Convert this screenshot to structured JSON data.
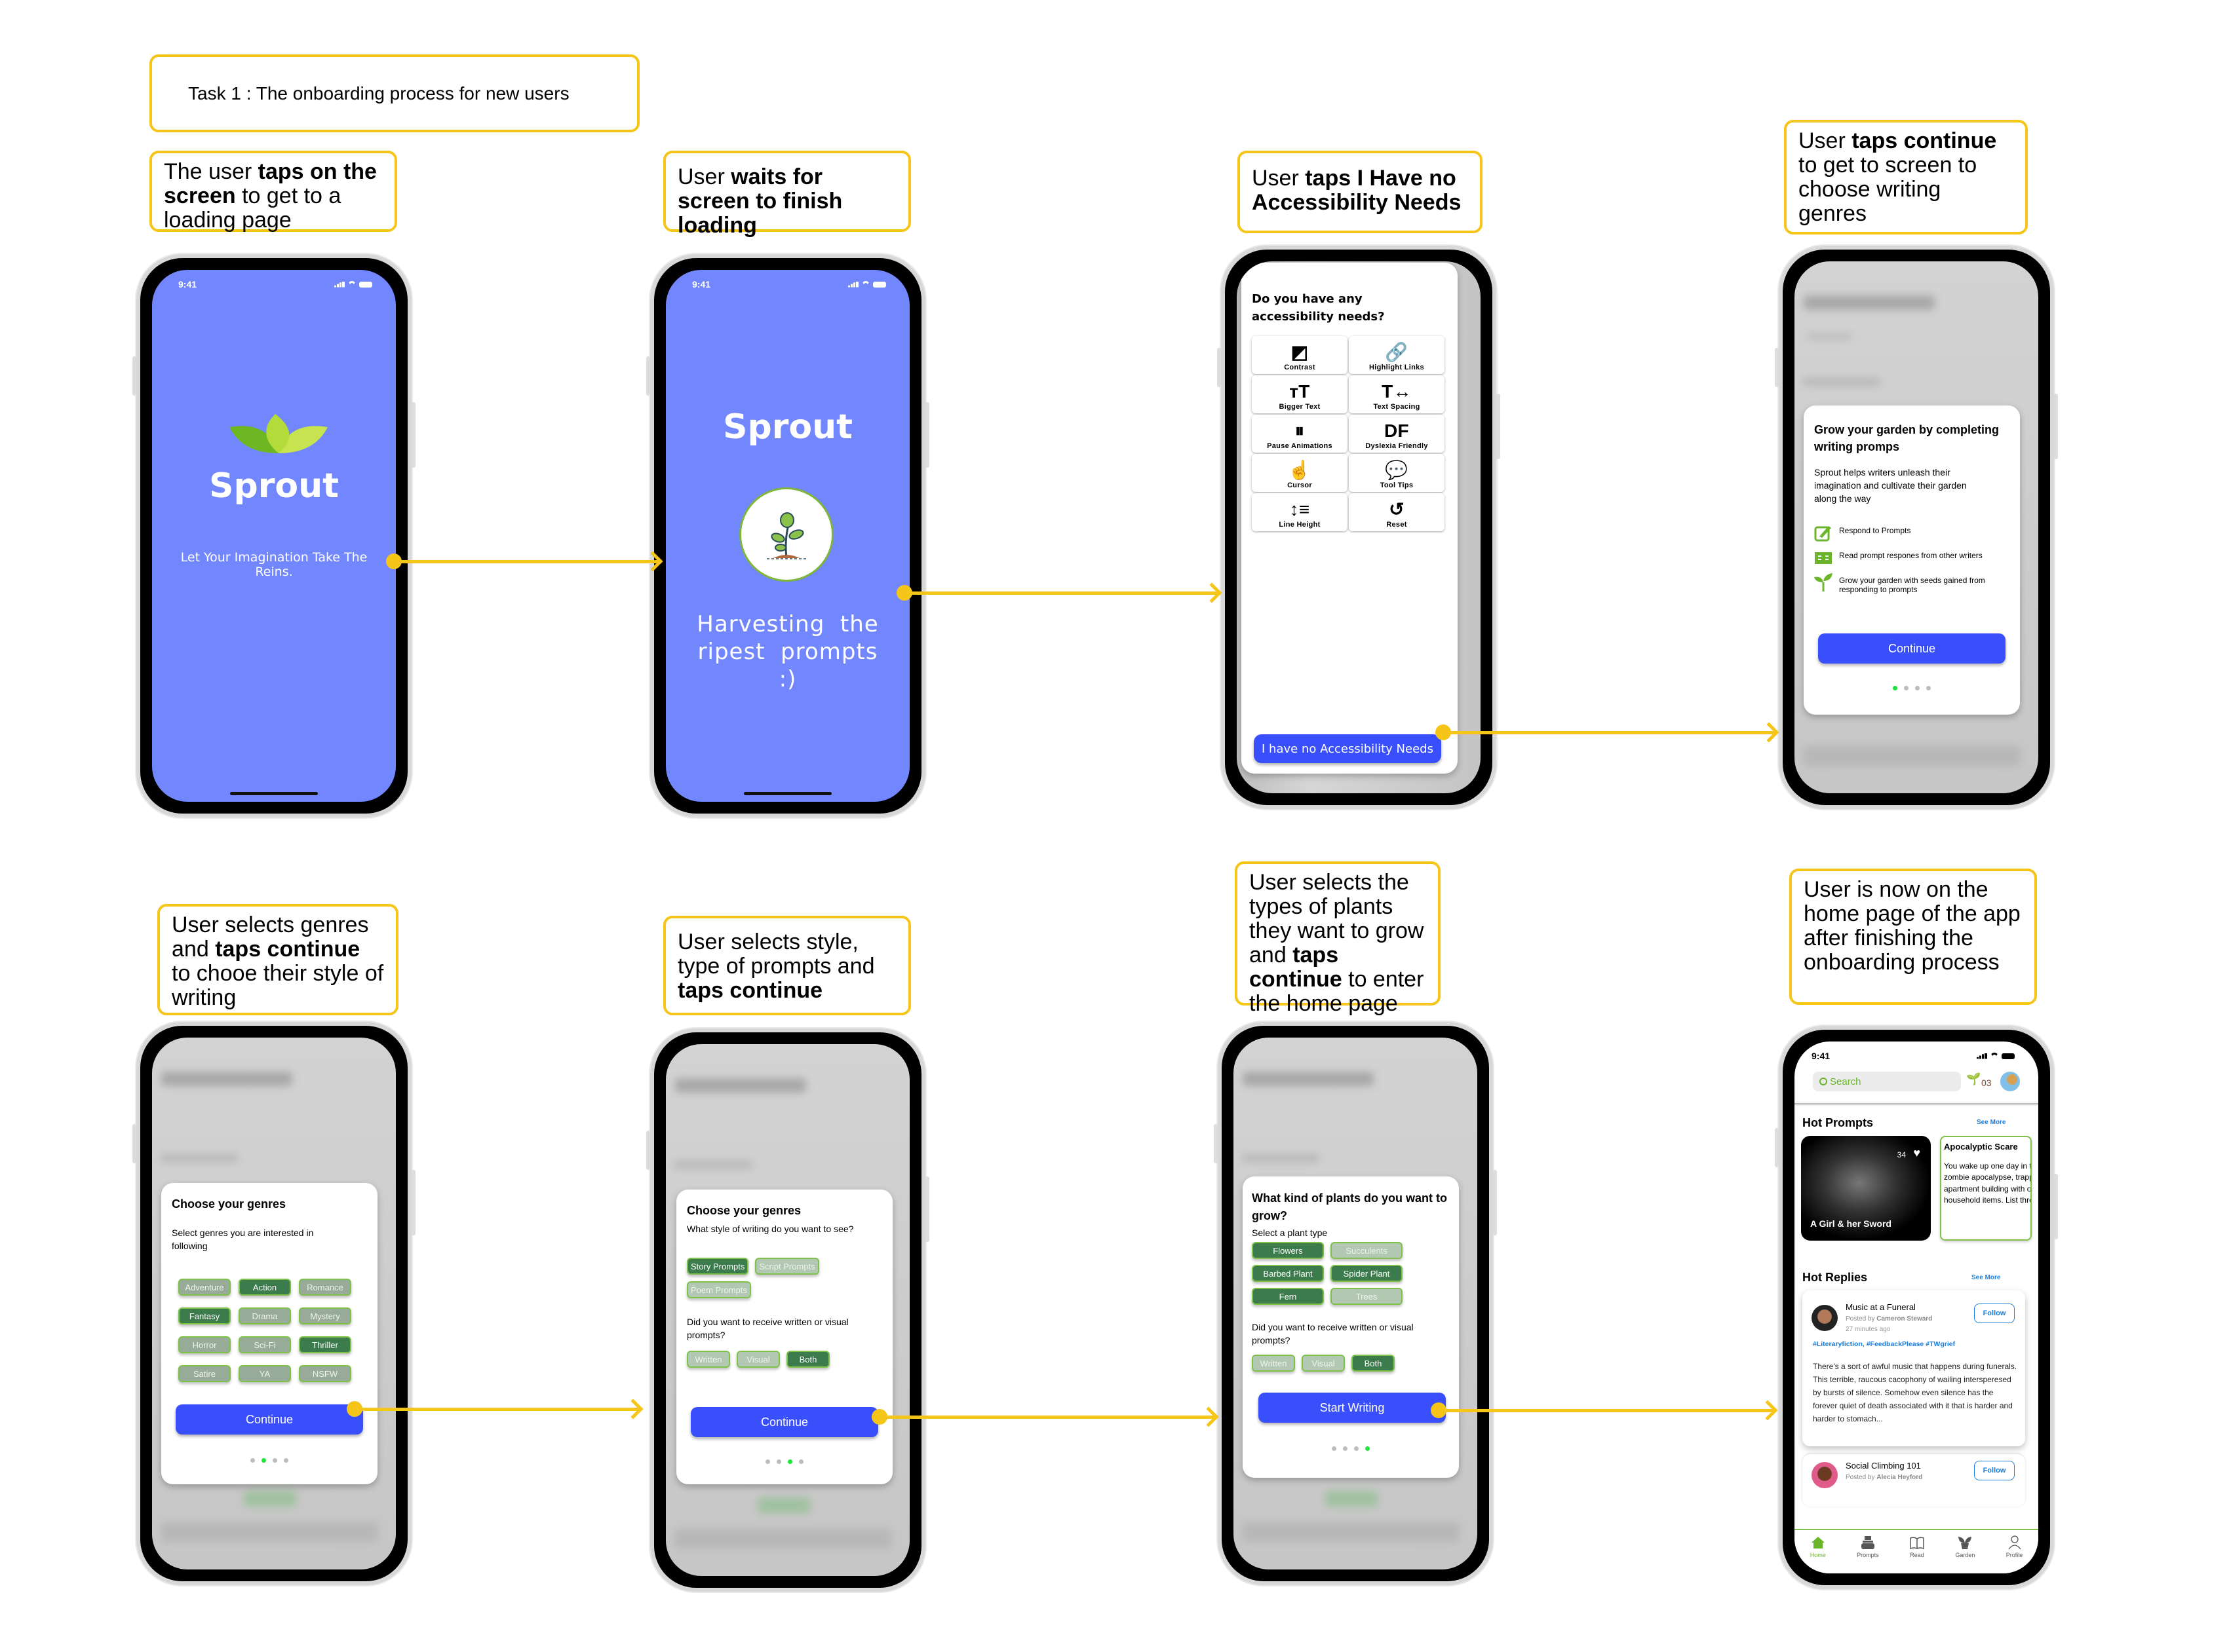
{
  "task_title": "Task 1 : The onboarding process for new users",
  "steps": [
    {
      "parts": [
        {
          "t": "The user "
        },
        {
          "t": "taps on the screen",
          "b": true
        },
        {
          "t": " to get to a loading page"
        }
      ]
    },
    {
      "parts": [
        {
          "t": "User "
        },
        {
          "t": "waits for screen to finish loading",
          "b": true
        }
      ]
    },
    {
      "parts": [
        {
          "t": "User "
        },
        {
          "t": "taps I Have no Accessibility Needs",
          "b": true
        }
      ]
    },
    {
      "parts": [
        {
          "t": "User "
        },
        {
          "t": "taps continue",
          "b": true
        },
        {
          "t": " to get to screen to choose writing genres"
        }
      ]
    },
    {
      "parts": [
        {
          "t": "User selects genres and "
        },
        {
          "t": "taps continue",
          "b": true
        },
        {
          "t": " to chooe their style of writing"
        }
      ]
    },
    {
      "parts": [
        {
          "t": "User selects style, type of prompts and "
        },
        {
          "t": "taps continue",
          "b": true
        }
      ]
    },
    {
      "parts": [
        {
          "t": "User selects the types of plants they want to grow and "
        },
        {
          "t": "taps continue",
          "b": true
        },
        {
          "t": " to enter the home page"
        }
      ]
    },
    {
      "parts": [
        {
          "t": "User is now on the home page of the app after finishing the onboarding process"
        }
      ]
    }
  ],
  "status_time": "9:41",
  "splash": {
    "app_name": "Sprout",
    "tagline": "Let Your Imagination Take The Reins."
  },
  "loading": {
    "app_name": "Sprout",
    "message": "Harvesting  the ripest  prompts  :)"
  },
  "accessibility": {
    "title": "Do you have any accessibility needs?",
    "options": [
      {
        "label": "Contrast",
        "icon": "contrast-icon",
        "glyph": "◩"
      },
      {
        "label": "Highlight Links",
        "icon": "link-icon",
        "glyph": "🔗"
      },
      {
        "label": "Bigger Text",
        "icon": "text-size-icon",
        "glyph": "тT"
      },
      {
        "label": "Text Spacing",
        "icon": "text-spacing-icon",
        "glyph": "T↔"
      },
      {
        "label": "Pause Animations",
        "icon": "pause-icon",
        "glyph": "⏸"
      },
      {
        "label": "Dyslexia Friendly",
        "icon": "dyslexia-icon",
        "glyph": "DF"
      },
      {
        "label": "Cursor",
        "icon": "cursor-hand-icon",
        "glyph": "☝"
      },
      {
        "label": "Tool Tips",
        "icon": "tooltip-icon",
        "glyph": "💬"
      },
      {
        "label": "Line Height",
        "icon": "line-height-icon",
        "glyph": "↕≡"
      },
      {
        "label": "Reset",
        "icon": "reset-icon",
        "glyph": "↺"
      }
    ],
    "button": "I have no Accessibility Needs"
  },
  "intro": {
    "bg_title": "Story Weaver",
    "title": "Grow your garden by completing writing promps",
    "body": "Sprout helps writers unleash their imagination and cultivate their garden along the way",
    "features": [
      {
        "icon": "edit-icon",
        "text": "Respond to Prompts"
      },
      {
        "icon": "book-icon",
        "text": "Read prompt respones from other writers"
      },
      {
        "icon": "sprout-icon",
        "text": "Grow your garden with seeds gained from responding to prompts"
      }
    ],
    "button": "Continue",
    "page": 1,
    "pages": 4
  },
  "genres": {
    "title": "Choose your genres",
    "subtitle": "Select genres you are interested in following",
    "options": [
      {
        "label": "Adventure",
        "selected": false
      },
      {
        "label": "Action",
        "selected": true
      },
      {
        "label": "Romance",
        "selected": false
      },
      {
        "label": "Fantasy",
        "selected": true
      },
      {
        "label": "Drama",
        "selected": false
      },
      {
        "label": "Mystery",
        "selected": false
      },
      {
        "label": "Horror",
        "selected": false
      },
      {
        "label": "Sci-Fi",
        "selected": false
      },
      {
        "label": "Thriller",
        "selected": true
      },
      {
        "label": "Satire",
        "selected": false
      },
      {
        "label": "YA",
        "selected": false
      },
      {
        "label": "NSFW",
        "selected": false
      }
    ],
    "button": "Continue",
    "page": 2,
    "pages": 4
  },
  "style": {
    "title": "Choose your genres",
    "q1": "What style of writing do you want to see?",
    "styles": [
      {
        "label": "Story Prompts",
        "selected": true
      },
      {
        "label": "Script Prompts",
        "selected": false
      },
      {
        "label": "Poem Prompts",
        "selected": false
      }
    ],
    "q2": "Did you want to receive written or visual prompts?",
    "formats": [
      {
        "label": "Written",
        "selected": false
      },
      {
        "label": "Visual",
        "selected": false
      },
      {
        "label": "Both",
        "selected": true
      }
    ],
    "button": "Continue",
    "page": 3,
    "pages": 4
  },
  "plants": {
    "title": "What kind of plants do you want to grow?",
    "subtitle": "Select a plant type",
    "options": [
      {
        "label": "Flowers",
        "selected": true
      },
      {
        "label": "Succulents",
        "selected": false
      },
      {
        "label": "Barbed Plant",
        "selected": true
      },
      {
        "label": "Spider Plant",
        "selected": true
      },
      {
        "label": "Fern",
        "selected": true
      },
      {
        "label": "Trees",
        "selected": false
      }
    ],
    "q2": "Did you want to receive written or visual prompts?",
    "formats": [
      {
        "label": "Written",
        "selected": false
      },
      {
        "label": "Visual",
        "selected": false
      },
      {
        "label": "Both",
        "selected": true
      }
    ],
    "button": "Start Writing",
    "page": 4,
    "pages": 4
  },
  "home": {
    "search_placeholder": "Search",
    "seed_count": "03",
    "hot_prompts": "Hot Prompts",
    "see_more": "See More",
    "prompt_card_1": {
      "title": "A Girl & her Sword",
      "likes": "34"
    },
    "prompt_card_2": {
      "title": "Apocalyptic Scare",
      "body": "You wake up one day in the middle of a zombie apocalypse, trapped in your apartment building with only your household items. List three things..."
    },
    "hot_replies": "Hot Replies",
    "replies": [
      {
        "title": "Music at a Funeral",
        "posted_by": "Posted by",
        "author": "Cameron Steward",
        "time": "27 minutes ago",
        "tags": "#Literaryfiction, #FeedbackPlease #TWgrief",
        "body": "There's a sort of awful music that happens during funerals. This terrible, raucous cacophony of wailing intersperesed by bursts of silence. Somehow even silence has the forever quiet of death associated with it that is harder and harder to stomach...",
        "follow": "Follow"
      },
      {
        "title": "Social Climbing 101",
        "posted_by": "Posted by",
        "author": "Alecia Heyford",
        "follow": "Follow"
      }
    ],
    "tabs": [
      {
        "label": "Home",
        "icon": "home-icon",
        "active": true
      },
      {
        "label": "Prompts",
        "icon": "typewriter-icon",
        "active": false
      },
      {
        "label": "Read",
        "icon": "book-open-icon",
        "active": false
      },
      {
        "label": "Garden",
        "icon": "plant-pot-icon",
        "active": false
      },
      {
        "label": "Profile",
        "icon": "profile-icon",
        "active": false
      }
    ]
  },
  "colors": {
    "accent_yellow": "#f5c518",
    "splash_blue": "#7286fd",
    "button_blue": "#3a4ffc",
    "chip_green": "#3b7b4c",
    "leaf_green": "#6bb52a",
    "dot_active": "#1ee53a",
    "link_blue": "#1a7fe0"
  }
}
